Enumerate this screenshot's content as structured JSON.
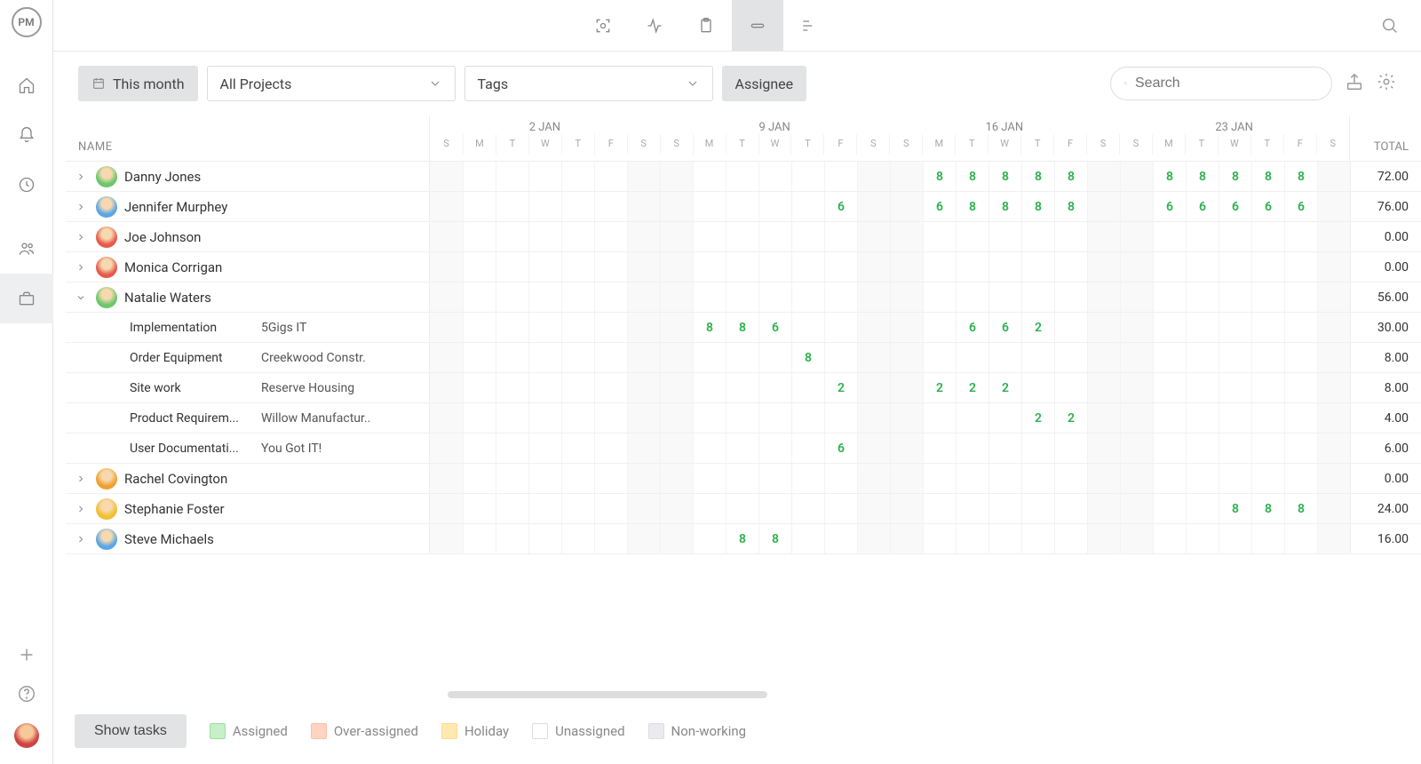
{
  "brand": "PM",
  "toolbar": {
    "period_label": "This month",
    "projects_label": "All Projects",
    "tags_label": "Tags",
    "assignee_label": "Assignee",
    "search_placeholder": "Search"
  },
  "grid": {
    "name_header": "NAME",
    "total_header": "TOTAL",
    "weeks": [
      "2 JAN",
      "9 JAN",
      "16 JAN",
      "23 JAN"
    ],
    "days": [
      "S",
      "M",
      "T",
      "W",
      "T",
      "F",
      "S",
      "S",
      "M",
      "T",
      "W",
      "T",
      "F",
      "S",
      "S",
      "M",
      "T",
      "W",
      "T",
      "F",
      "S",
      "S",
      "M",
      "T",
      "W",
      "T",
      "F",
      "S"
    ],
    "weekend_idx": [
      0,
      6,
      7,
      13,
      14,
      20,
      21,
      27
    ]
  },
  "rows": [
    {
      "type": "person",
      "name": "Danny Jones",
      "avatar": "#6bc76b",
      "expanded": false,
      "total": "72.00",
      "cells": {
        "15": "8",
        "16": "8",
        "17": "8",
        "18": "8",
        "19": "8",
        "22": "8",
        "23": "8",
        "24": "8",
        "25": "8",
        "26": "8"
      }
    },
    {
      "type": "person",
      "name": "Jennifer Murphey",
      "avatar": "#5aa6e6",
      "expanded": false,
      "total": "76.00",
      "cells": {
        "12": "6",
        "15": "6",
        "16": "8",
        "17": "8",
        "18": "8",
        "19": "8",
        "22": "6",
        "23": "6",
        "24": "6",
        "25": "6",
        "26": "6"
      }
    },
    {
      "type": "person",
      "name": "Joe Johnson",
      "avatar": "#e65a4a",
      "expanded": false,
      "total": "0.00",
      "cells": {}
    },
    {
      "type": "person",
      "name": "Monica Corrigan",
      "avatar": "#e65a4a",
      "expanded": false,
      "total": "0.00",
      "cells": {}
    },
    {
      "type": "person",
      "name": "Natalie Waters",
      "avatar": "#6bc76b",
      "expanded": true,
      "total": "56.00",
      "cells": {}
    },
    {
      "type": "task",
      "task": "Implementation",
      "project": "5Gigs IT",
      "total": "30.00",
      "cells": {
        "8": "8",
        "9": "8",
        "10": "6",
        "16": "6",
        "17": "6",
        "18": "2"
      }
    },
    {
      "type": "task",
      "task": "Order Equipment",
      "project": "Creekwood Constr.",
      "total": "8.00",
      "cells": {
        "11": "8"
      }
    },
    {
      "type": "task",
      "task": "Site work",
      "project": "Reserve Housing",
      "total": "8.00",
      "cells": {
        "12": "2",
        "15": "2",
        "16": "2",
        "17": "2"
      }
    },
    {
      "type": "task",
      "task": "Product Requirem...",
      "project": "Willow Manufactur..",
      "total": "4.00",
      "cells": {
        "18": "2",
        "19": "2"
      }
    },
    {
      "type": "task",
      "task": "User Documentati...",
      "project": "You Got IT!",
      "total": "6.00",
      "cells": {
        "12": "6"
      }
    },
    {
      "type": "person",
      "name": "Rachel Covington",
      "avatar": "#f0a030",
      "expanded": false,
      "total": "0.00",
      "cells": {}
    },
    {
      "type": "person",
      "name": "Stephanie Foster",
      "avatar": "#f0c030",
      "expanded": false,
      "total": "24.00",
      "cells": {
        "24": "8",
        "25": "8",
        "26": "8"
      }
    },
    {
      "type": "person",
      "name": "Steve Michaels",
      "avatar": "#5aa6e6",
      "expanded": false,
      "total": "16.00",
      "cells": {
        "9": "8",
        "10": "8"
      }
    }
  ],
  "footer": {
    "show_tasks": "Show tasks",
    "legend": {
      "assigned": "Assigned",
      "over": "Over-assigned",
      "holiday": "Holiday",
      "unassigned": "Unassigned",
      "nonworking": "Non-working"
    }
  }
}
